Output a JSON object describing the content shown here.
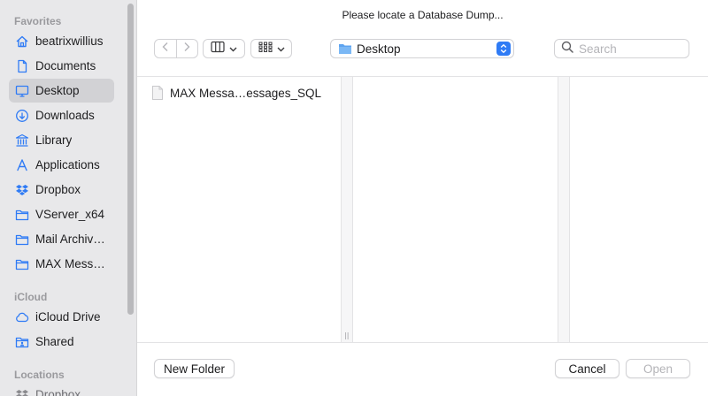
{
  "window": {
    "title": "Please locate a Database Dump..."
  },
  "sidebar": {
    "sections": [
      {
        "label": "Favorites"
      },
      {
        "label": "iCloud"
      },
      {
        "label": "Locations"
      }
    ],
    "favorites": [
      {
        "label": "beatrixwillius",
        "icon": "home-icon"
      },
      {
        "label": "Documents",
        "icon": "document-icon"
      },
      {
        "label": "Desktop",
        "icon": "desktop-icon",
        "selected": true
      },
      {
        "label": "Downloads",
        "icon": "download-icon"
      },
      {
        "label": "Library",
        "icon": "library-icon"
      },
      {
        "label": "Applications",
        "icon": "applications-icon"
      },
      {
        "label": "Dropbox",
        "icon": "dropbox-icon"
      },
      {
        "label": "VServer_x64",
        "icon": "folder-icon"
      },
      {
        "label": "Mail Archiv…",
        "icon": "folder-icon"
      },
      {
        "label": "MAX Mess…",
        "icon": "folder-icon"
      }
    ],
    "icloud": [
      {
        "label": "iCloud Drive",
        "icon": "cloud-icon"
      },
      {
        "label": "Shared",
        "icon": "shared-folder-icon"
      }
    ],
    "locations": [
      {
        "label": "Dropbox",
        "icon": "dropbox-icon"
      }
    ]
  },
  "toolbar": {
    "location": "Desktop",
    "search_placeholder": "Search"
  },
  "browser": {
    "files": [
      {
        "name": "MAX Messa…essages_SQL",
        "icon": "file-icon"
      }
    ],
    "grip": "||"
  },
  "buttons": {
    "new_folder": "New Folder",
    "cancel": "Cancel",
    "open": "Open"
  },
  "colors": {
    "accent": "#2f7bf5",
    "sidebar_bg": "#e8e8ea",
    "selected_bg": "#d2d2d5"
  }
}
